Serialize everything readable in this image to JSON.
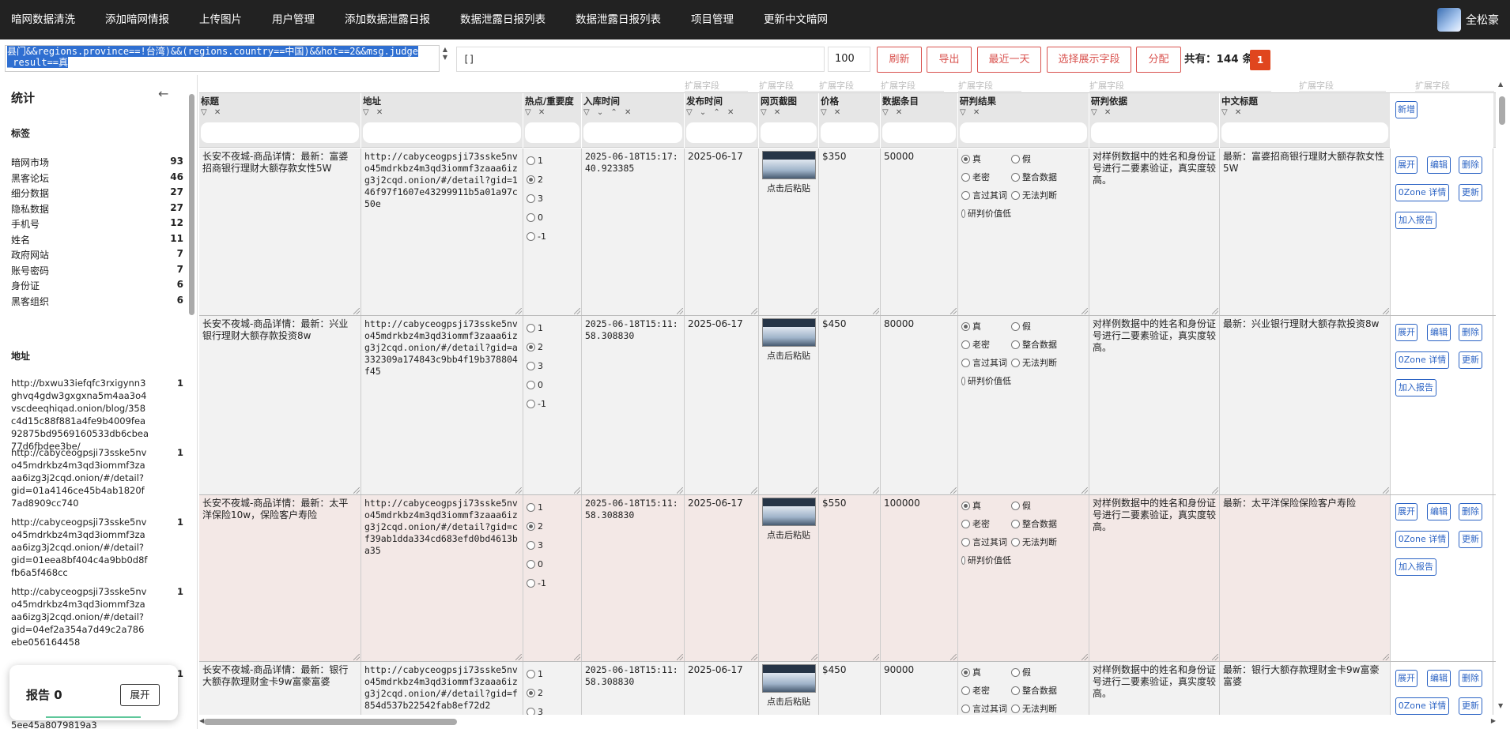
{
  "nav": {
    "items": [
      "暗网数据清洗",
      "添加暗网情报",
      "上传图片",
      "用户管理",
      "添加数据泄露日报",
      "数据泄露日报列表",
      "数据泄露日报列表",
      "项目管理",
      "更新中文暗网"
    ],
    "user_name": "全松豪"
  },
  "toolbar": {
    "query_text": "县门&&regions.province==!台湾)&&(regions.country==中国)&&hot==2&&msg.judge_result==真",
    "fields_value": "[]",
    "page_size": "100",
    "refresh": "刷新",
    "export": "导出",
    "last_day": "最近一天",
    "select_fields": "选择展示字段",
    "assign": "分配",
    "total_label": "共有：",
    "total_count": "144",
    "total_unit": "条",
    "page": "1"
  },
  "sidebar": {
    "title": "统计",
    "collapse_icon": "arrow-left-icon",
    "tags_title": "标签",
    "tags": [
      {
        "label": "暗网市场",
        "count": "93"
      },
      {
        "label": "黑客论坛",
        "count": "46"
      },
      {
        "label": "细分数据",
        "count": "27"
      },
      {
        "label": "隐私数据",
        "count": "27"
      },
      {
        "label": "手机号",
        "count": "12"
      },
      {
        "label": "姓名",
        "count": "11"
      },
      {
        "label": "政府网站",
        "count": "7"
      },
      {
        "label": "账号密码",
        "count": "7"
      },
      {
        "label": "身份证",
        "count": "6"
      },
      {
        "label": "黑客组织",
        "count": "6"
      }
    ],
    "address_title": "地址",
    "addresses": [
      {
        "url": "http://bxwu33iefqfc3rxigynn3ghvq4gdw3gxgxna5m4aa3o4vscdeeqhiqad.onion/blog/358c4d15c88f881a4fe9b4009fea92875bd9569160533db6cbea77d6fbdee3be/",
        "count": "1"
      },
      {
        "url": "http://cabyceogpsji73sske5nvo45mdrkbz4m3qd3iommf3zaaa6izg3j2cqd.onion/#/detail?gid=01a4146ce45b4ab1820f7ad8909cc740",
        "count": "1"
      },
      {
        "url": "http://cabyceogpsji73sske5nvo45mdrkbz4m3qd3iommf3zaaa6izg3j2cqd.onion/#/detail?gid=01eea8bf404c4a9bb0d8ffb6a5f468cc",
        "count": "1"
      },
      {
        "url": "http://cabyceogpsji73sske5nvo45mdrkbz4m3qd3iommf3zaaa6izg3j2cqd.onion/#/detail?gid=04ef2a354a7d49c2a786ebe056164458",
        "count": "1"
      }
    ],
    "tail_text": "5ee45a8079819a3",
    "last_count": "1"
  },
  "report": {
    "label": "报告 0",
    "open": "展开"
  },
  "grid": {
    "ext_label": "扩展字段",
    "columns": [
      {
        "key": "title",
        "name": "标题",
        "filters": "▽ ✕"
      },
      {
        "key": "url",
        "name": "地址",
        "filters": "▽ ✕"
      },
      {
        "key": "hot",
        "name": "热点/重要度",
        "filters": "▽ ✕"
      },
      {
        "key": "ts",
        "name": "入库时间",
        "filters": "▽ ⌄ ⌃ ✕"
      },
      {
        "key": "pub",
        "name": "发布时间",
        "filters": "▽ ⌄ ⌃ ✕"
      },
      {
        "key": "shot",
        "name": "网页截图",
        "filters": "▽ ✕"
      },
      {
        "key": "price",
        "name": "价格",
        "filters": "▽ ✕"
      },
      {
        "key": "num",
        "name": "数据条目",
        "filters": "▽ ✕"
      },
      {
        "key": "verdict",
        "name": "研判结果",
        "filters": "▽ ✕"
      },
      {
        "key": "basis",
        "name": "研判依据",
        "filters": "▽ ✕"
      },
      {
        "key": "cn",
        "name": "中文标题",
        "filters": "▽ ✕"
      }
    ],
    "new_button": "新增",
    "hot_options": [
      "1",
      "2",
      "3",
      "0",
      "-1"
    ],
    "verdict_options": [
      "真",
      "假",
      "老密",
      "整合数据",
      "言过其词",
      "无法判断",
      "研判价值低"
    ],
    "paste_label": "点击后粘贴",
    "ops": {
      "expand": "展开",
      "edit": "编辑",
      "delete": "删除",
      "ozone": "0Zone 详情",
      "update": "更新",
      "add_report": "加入报告"
    },
    "rows": [
      {
        "title": "长安不夜城-商品详情：最新：富婆招商银行理财大额存款女性5W",
        "url": "http://cabyceogpsji73sske5nvo45mdrkbz4m3qd3iommf3zaaa6izg3j2cqd.onion/#/detail?gid=146f97f1607e43299911b5a01a97c50e",
        "ts": "2025-06-18T15:17:40.923385",
        "pub": "2025-06-17",
        "price": "$350",
        "num": "50000",
        "basis": "对样例数据中的姓名和身份证号进行二要素验证，真实度较高。",
        "cn": "最新：富婆招商银行理财大额存款女性5W"
      },
      {
        "title": "长安不夜城-商品详情：最新：兴业银行理财大额存款投资8w",
        "url": "http://cabyceogpsji73sske5nvo45mdrkbz4m3qd3iommf3zaaa6izg3j2cqd.onion/#/detail?gid=a332309a174843c9bb4f19b378804f45",
        "ts": "2025-06-18T15:11:58.308830",
        "pub": "2025-06-17",
        "price": "$450",
        "num": "80000",
        "basis": "对样例数据中的姓名和身份证号进行二要素验证，真实度较高。",
        "cn": "最新：兴业银行理财大额存款投资8w"
      },
      {
        "title": "长安不夜城-商品详情：最新：太平洋保险10w，保险客户寿险",
        "url": "http://cabyceogpsji73sske5nvo45mdrkbz4m3qd3iommf3zaaa6izg3j2cqd.onion/#/detail?gid=cf39ab1dda334cd683efd0bd4613ba35",
        "ts": "2025-06-18T15:11:58.308830",
        "pub": "2025-06-17",
        "price": "$550",
        "num": "100000",
        "basis": "对样例数据中的姓名和身份证号进行二要素验证，真实度较高。",
        "cn": "最新：太平洋保险保险客户寿险"
      },
      {
        "title": "长安不夜城-商品详情：最新：银行大额存款理财金卡9w富豪富婆",
        "url": "http://cabyceogpsji73sske5nvo45mdrkbz4m3qd3iommf3zaaa6izg3j2cqd.onion/#/detail?gid=f854d537b22542fab8ef72d2",
        "ts": "2025-06-18T15:11:58.308830",
        "pub": "2025-06-17",
        "price": "$450",
        "num": "90000",
        "basis": "对样例数据中的姓名和身份证号进行二要素验证，真实度较高。",
        "cn": "最新：银行大额存款理财金卡9w富豪富婆"
      }
    ]
  }
}
